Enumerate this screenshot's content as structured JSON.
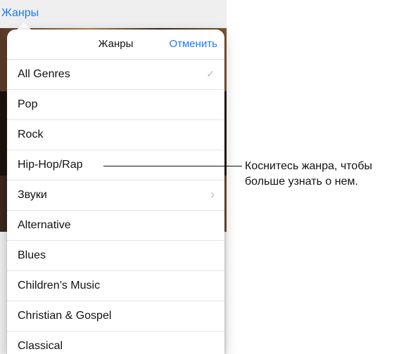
{
  "nav": {
    "back_label": "Жанры"
  },
  "popover": {
    "title": "Жанры",
    "cancel_label": "Отменить",
    "items": [
      {
        "label": "All Genres",
        "accessory": "checkmark-icon"
      },
      {
        "label": "Pop"
      },
      {
        "label": "Rock"
      },
      {
        "label": "Hip-Hop/Rap"
      },
      {
        "label": "Звуки",
        "accessory": "chevron-right-icon"
      },
      {
        "label": "Alternative"
      },
      {
        "label": "Blues"
      },
      {
        "label": "Children’s Music"
      },
      {
        "label": "Christian & Gospel"
      },
      {
        "label": "Classical"
      }
    ]
  },
  "callout": {
    "line1": "Коснитесь жанра, чтобы",
    "line2": "больше узнать о нем."
  },
  "colors": {
    "accent": "#1a7cf5",
    "separator": "#e3e3e6"
  }
}
